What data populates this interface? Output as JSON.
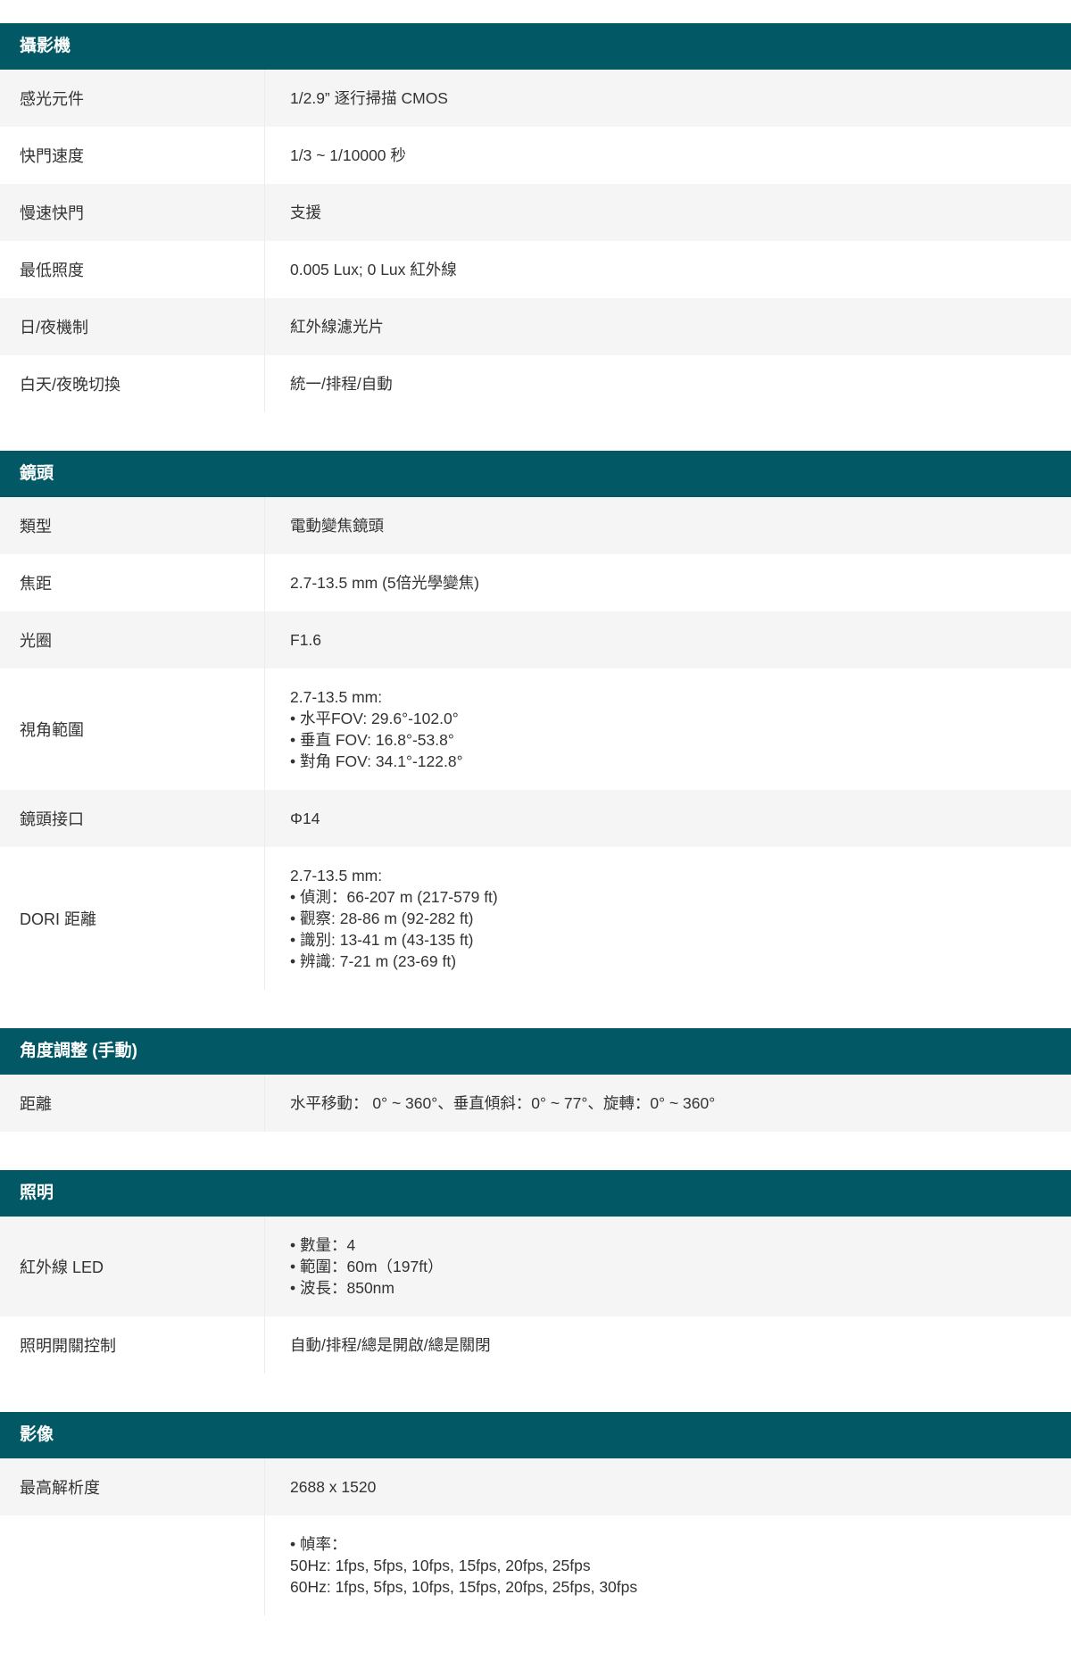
{
  "sections": [
    {
      "title": "攝影機",
      "rows": [
        {
          "label": "感光元件",
          "lines": [
            "1/2.9” 逐行掃描 CMOS"
          ]
        },
        {
          "label": "快門速度",
          "lines": [
            "1/3 ~ 1/10000 秒"
          ]
        },
        {
          "label": "慢速快門",
          "lines": [
            "支援"
          ]
        },
        {
          "label": "最低照度",
          "lines": [
            "0.005 Lux; 0 Lux 紅外線"
          ]
        },
        {
          "label": "日/夜機制",
          "lines": [
            "紅外線濾光片"
          ]
        },
        {
          "label": "白天/夜晚切換",
          "lines": [
            "統一/排程/自動"
          ]
        }
      ]
    },
    {
      "title": "鏡頭",
      "rows": [
        {
          "label": "類型",
          "lines": [
            "電動變焦鏡頭"
          ]
        },
        {
          "label": "焦距",
          "lines": [
            "2.7-13.5 mm (5倍光學變焦)"
          ]
        },
        {
          "label": "光圈",
          "lines": [
            "F1.6"
          ]
        },
        {
          "label": "視角範圍",
          "lines": [
            "2.7-13.5 mm:",
            "• 水平FOV: 29.6°-102.0°",
            "• 垂直 FOV: 16.8°-53.8°",
            "• 對角 FOV: 34.1°-122.8°"
          ]
        },
        {
          "label": "鏡頭接口",
          "lines": [
            "Φ14"
          ]
        },
        {
          "label": "DORI 距離",
          "lines": [
            "2.7-13.5 mm:",
            "• 偵測：66-207 m (217-579 ft)",
            "• 觀察: 28-86 m (92-282 ft)",
            "• 識別: 13-41 m (43-135 ft)",
            "• 辨識: 7-21 m (23-69 ft)"
          ]
        }
      ]
    },
    {
      "title": "角度調整 (手動)",
      "rows": [
        {
          "label": "距離",
          "lines": [
            "水平移動： 0° ~ 360°、垂直傾斜：0° ~ 77°、旋轉：0° ~ 360°"
          ]
        }
      ]
    },
    {
      "title": "照明",
      "rows": [
        {
          "label": "紅外線 LED",
          "lines": [
            "• 數量：4",
            "• 範圍：60m（197ft）",
            "• 波長：850nm"
          ]
        },
        {
          "label": "照明開關控制",
          "lines": [
            "自動/排程/總是開啟/總是關閉"
          ]
        }
      ]
    },
    {
      "title": "影像",
      "rows": [
        {
          "label": "最高解析度",
          "lines": [
            "2688 x 1520"
          ]
        },
        {
          "label": "",
          "lines": [
            "• 幀率：",
            "50Hz: 1fps, 5fps, 10fps, 15fps, 20fps, 25fps",
            "60Hz: 1fps, 5fps, 10fps, 15fps, 20fps, 25fps, 30fps"
          ]
        }
      ]
    }
  ]
}
